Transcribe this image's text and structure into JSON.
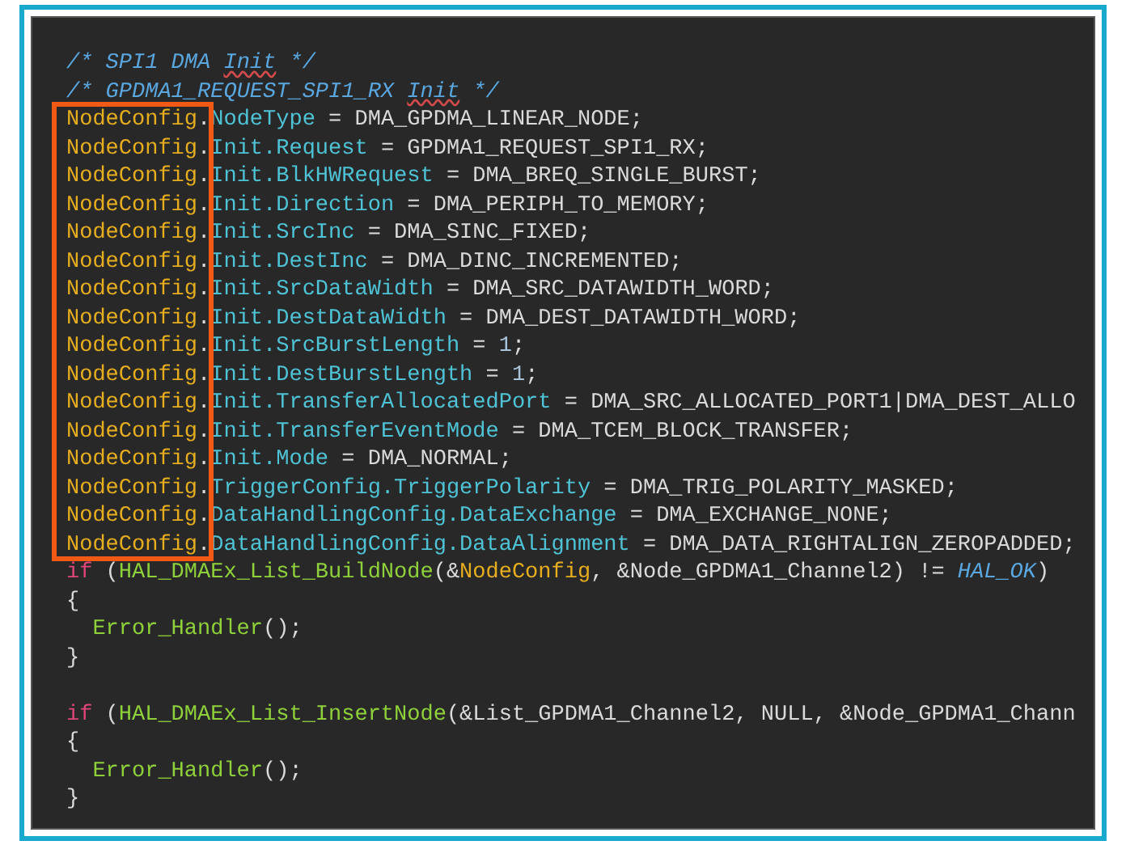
{
  "code_lines": [
    {
      "kind": "code",
      "tokens": [
        {
          "text": "/* SPI1 DMA ",
          "kind": "comment"
        },
        {
          "text": "Init",
          "kind": "comment_misspelled"
        },
        {
          "text": " */",
          "kind": "comment"
        }
      ]
    },
    {
      "kind": "code",
      "tokens": [
        {
          "text": "/* GPDMA1_REQUEST_SPI1_RX ",
          "kind": "comment"
        },
        {
          "text": "Init",
          "kind": "comment_misspelled"
        },
        {
          "text": " */",
          "kind": "comment"
        }
      ]
    },
    {
      "kind": "code",
      "tokens": [
        {
          "text": "NodeConfig",
          "kind": "variable"
        },
        {
          "text": ".",
          "kind": "plain"
        },
        {
          "text": "NodeType",
          "kind": "member"
        },
        {
          "text": " = DMA_GPDMA_LINEAR_NODE;",
          "kind": "plain"
        }
      ]
    },
    {
      "kind": "code",
      "tokens": [
        {
          "text": "NodeConfig",
          "kind": "variable"
        },
        {
          "text": ".",
          "kind": "plain"
        },
        {
          "text": "Init.Request",
          "kind": "member"
        },
        {
          "text": " = GPDMA1_REQUEST_SPI1_RX;",
          "kind": "plain"
        }
      ]
    },
    {
      "kind": "code",
      "tokens": [
        {
          "text": "NodeConfig",
          "kind": "variable"
        },
        {
          "text": ".",
          "kind": "plain"
        },
        {
          "text": "Init.BlkHWRequest",
          "kind": "member"
        },
        {
          "text": " = DMA_BREQ_SINGLE_BURST;",
          "kind": "plain"
        }
      ]
    },
    {
      "kind": "code",
      "tokens": [
        {
          "text": "NodeConfig",
          "kind": "variable"
        },
        {
          "text": ".",
          "kind": "plain"
        },
        {
          "text": "Init.Direction",
          "kind": "member"
        },
        {
          "text": " = DMA_PERIPH_TO_MEMORY;",
          "kind": "plain"
        }
      ]
    },
    {
      "kind": "code",
      "tokens": [
        {
          "text": "NodeConfig",
          "kind": "variable"
        },
        {
          "text": ".",
          "kind": "plain"
        },
        {
          "text": "Init.SrcInc",
          "kind": "member"
        },
        {
          "text": " = DMA_SINC_FIXED;",
          "kind": "plain"
        }
      ]
    },
    {
      "kind": "code",
      "tokens": [
        {
          "text": "NodeConfig",
          "kind": "variable"
        },
        {
          "text": ".",
          "kind": "plain"
        },
        {
          "text": "Init.DestInc",
          "kind": "member"
        },
        {
          "text": " = DMA_DINC_INCREMENTED;",
          "kind": "plain"
        }
      ]
    },
    {
      "kind": "code",
      "tokens": [
        {
          "text": "NodeConfig",
          "kind": "variable"
        },
        {
          "text": ".",
          "kind": "plain"
        },
        {
          "text": "Init.SrcDataWidth",
          "kind": "member"
        },
        {
          "text": " = DMA_SRC_DATAWIDTH_WORD;",
          "kind": "plain"
        }
      ]
    },
    {
      "kind": "code",
      "tokens": [
        {
          "text": "NodeConfig",
          "kind": "variable"
        },
        {
          "text": ".",
          "kind": "plain"
        },
        {
          "text": "Init.DestDataWidth",
          "kind": "member"
        },
        {
          "text": " = DMA_DEST_DATAWIDTH_WORD;",
          "kind": "plain"
        }
      ]
    },
    {
      "kind": "code",
      "tokens": [
        {
          "text": "NodeConfig",
          "kind": "variable"
        },
        {
          "text": ".",
          "kind": "plain"
        },
        {
          "text": "Init.SrcBurstLength",
          "kind": "member"
        },
        {
          "text": " = ",
          "kind": "plain"
        },
        {
          "text": "1",
          "kind": "number"
        },
        {
          "text": ";",
          "kind": "plain"
        }
      ]
    },
    {
      "kind": "code",
      "tokens": [
        {
          "text": "NodeConfig",
          "kind": "variable"
        },
        {
          "text": ".",
          "kind": "plain"
        },
        {
          "text": "Init.DestBurstLength",
          "kind": "member"
        },
        {
          "text": " = ",
          "kind": "plain"
        },
        {
          "text": "1",
          "kind": "number"
        },
        {
          "text": ";",
          "kind": "plain"
        }
      ]
    },
    {
      "kind": "code",
      "tokens": [
        {
          "text": "NodeConfig",
          "kind": "variable"
        },
        {
          "text": ".",
          "kind": "plain"
        },
        {
          "text": "Init.TransferAllocatedPort",
          "kind": "member"
        },
        {
          "text": " = DMA_SRC_ALLOCATED_PORT1|DMA_DEST_ALLO",
          "kind": "plain"
        }
      ]
    },
    {
      "kind": "code",
      "tokens": [
        {
          "text": "NodeConfig",
          "kind": "variable"
        },
        {
          "text": ".",
          "kind": "plain"
        },
        {
          "text": "Init.TransferEventMode",
          "kind": "member"
        },
        {
          "text": " = DMA_TCEM_BLOCK_TRANSFER;",
          "kind": "plain"
        }
      ]
    },
    {
      "kind": "code",
      "tokens": [
        {
          "text": "NodeConfig",
          "kind": "variable"
        },
        {
          "text": ".",
          "kind": "plain"
        },
        {
          "text": "Init.Mode",
          "kind": "member"
        },
        {
          "text": " = DMA_NORMAL;",
          "kind": "plain"
        }
      ]
    },
    {
      "kind": "code",
      "tokens": [
        {
          "text": "NodeConfig",
          "kind": "variable"
        },
        {
          "text": ".",
          "kind": "plain"
        },
        {
          "text": "TriggerConfig.TriggerPolarity",
          "kind": "member"
        },
        {
          "text": " = DMA_TRIG_POLARITY_MASKED;",
          "kind": "plain"
        }
      ]
    },
    {
      "kind": "code",
      "tokens": [
        {
          "text": "NodeConfig",
          "kind": "variable"
        },
        {
          "text": ".",
          "kind": "plain"
        },
        {
          "text": "DataHandlingConfig.DataExchange",
          "kind": "member"
        },
        {
          "text": " = DMA_EXCHANGE_NONE;",
          "kind": "plain"
        }
      ]
    },
    {
      "kind": "code",
      "tokens": [
        {
          "text": "NodeConfig",
          "kind": "variable"
        },
        {
          "text": ".",
          "kind": "plain"
        },
        {
          "text": "DataHandlingConfig.DataAlignment",
          "kind": "member"
        },
        {
          "text": " = DMA_DATA_RIGHTALIGN_ZEROPADDED;",
          "kind": "plain"
        }
      ]
    },
    {
      "kind": "code",
      "tokens": [
        {
          "text": "if",
          "kind": "keyword"
        },
        {
          "text": " (",
          "kind": "plain"
        },
        {
          "text": "HAL_DMAEx_List_BuildNode",
          "kind": "function"
        },
        {
          "text": "(&",
          "kind": "plain"
        },
        {
          "text": "NodeConfig",
          "kind": "variable"
        },
        {
          "text": ", &Node_GPDMA1_Channel2) != ",
          "kind": "plain"
        },
        {
          "text": "HAL_OK",
          "kind": "macro"
        },
        {
          "text": ")",
          "kind": "plain"
        }
      ]
    },
    {
      "kind": "code",
      "tokens": [
        {
          "text": "{",
          "kind": "plain"
        }
      ]
    },
    {
      "kind": "code",
      "indented": true,
      "tokens": [
        {
          "text": "Error_Handler",
          "kind": "function"
        },
        {
          "text": "();",
          "kind": "plain"
        }
      ]
    },
    {
      "kind": "code",
      "tokens": [
        {
          "text": "}",
          "kind": "plain"
        }
      ]
    },
    {
      "kind": "blank"
    },
    {
      "kind": "code",
      "tokens": [
        {
          "text": "if",
          "kind": "keyword"
        },
        {
          "text": " (",
          "kind": "plain"
        },
        {
          "text": "HAL_DMAEx_List_InsertNode",
          "kind": "function"
        },
        {
          "text": "(&List_GPDMA1_Channel2, NULL, &Node_GPDMA1_Chann",
          "kind": "plain"
        }
      ]
    },
    {
      "kind": "code",
      "tokens": [
        {
          "text": "{",
          "kind": "plain"
        }
      ]
    },
    {
      "kind": "code",
      "indented": true,
      "tokens": [
        {
          "text": "Error_Handler",
          "kind": "function"
        },
        {
          "text": "();",
          "kind": "plain"
        }
      ]
    },
    {
      "kind": "code",
      "tokens": [
        {
          "text": "}",
          "kind": "plain"
        }
      ]
    }
  ]
}
